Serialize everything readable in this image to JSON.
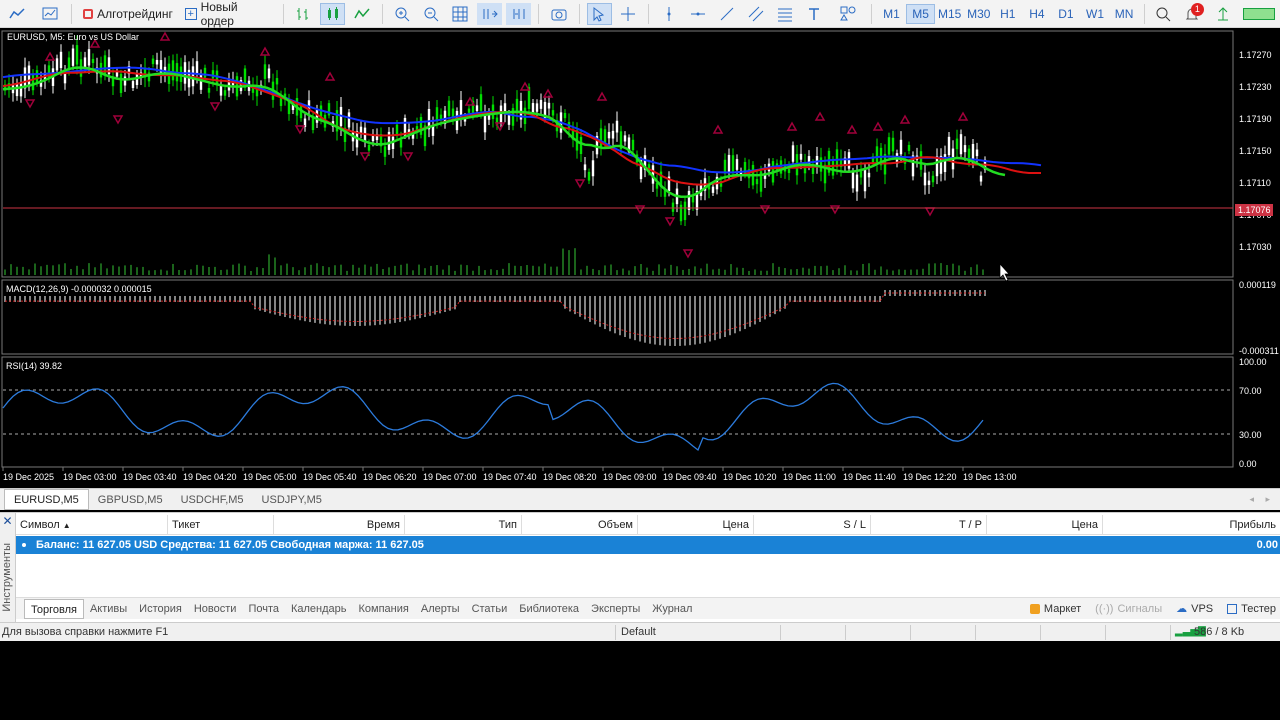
{
  "toolbar": {
    "algo_label": "Алготрейдинг",
    "new_order_label": "Новый ордер",
    "timeframes": [
      "M1",
      "M5",
      "M15",
      "M30",
      "H1",
      "H4",
      "D1",
      "W1",
      "MN"
    ],
    "active_timeframe": "M5",
    "notification_count": "1"
  },
  "chart": {
    "symbol_caption": "EURUSD, M5:  Euro vs US Dollar",
    "current_price_tag": "1.17076",
    "price_axis": [
      "1.17270",
      "1.17230",
      "1.17190",
      "1.17150",
      "1.17110",
      "1.17070",
      "1.17030"
    ],
    "macd_caption": "MACD(12,26,9) -0.000032 0.000015",
    "macd_axis_top": "0.000119",
    "macd_axis_bottom": "-0.000311",
    "rsi_caption": "RSI(14) 39.82",
    "rsi_axis": [
      "100.00",
      "70.00",
      "30.00",
      "0.00"
    ],
    "time_axis": [
      "19 Dec 2025",
      "19 Dec 03:00",
      "19 Dec 03:40",
      "19 Dec 04:20",
      "19 Dec 05:00",
      "19 Dec 05:40",
      "19 Dec 06:20",
      "19 Dec 07:00",
      "19 Dec 07:40",
      "19 Dec 08:20",
      "19 Dec 09:00",
      "19 Dec 09:40",
      "19 Dec 10:20",
      "19 Dec 11:00",
      "19 Dec 11:40",
      "19 Dec 12:20",
      "19 Dec 13:00"
    ],
    "colors": {
      "bull": "#00e000",
      "bear": "#ffffff",
      "ma_fast": "#22dd22",
      "ma_mid": "#dd1111",
      "ma_slow": "#1133ff",
      "fractal": "#a0003a",
      "bid_line": "#cc3344",
      "rsi": "#2c7bdc"
    }
  },
  "symbol_tabs": [
    "EURUSD,M5",
    "GBPUSD,M5",
    "USDCHF,M5",
    "USDJPY,M5"
  ],
  "toolbox": {
    "side_label": "Инструменты",
    "columns": [
      "Символ",
      "Тикет",
      "Время",
      "Тип",
      "Объем",
      "Цена",
      "S / L",
      "T / P",
      "Цена",
      "Прибыль"
    ],
    "balance_text": "Баланс: 11 627.05 USD  Средства: 11 627.05  Свободная маржа: 11 627.05",
    "profit": "0.00",
    "tabs": [
      "Торговля",
      "Активы",
      "История",
      "Новости",
      "Почта",
      "Календарь",
      "Компания",
      "Алерты",
      "Статьи",
      "Библиотека",
      "Эксперты",
      "Журнал"
    ],
    "right_tabs": [
      "Маркет",
      "Сигналы",
      "VPS",
      "Тестер"
    ]
  },
  "status": {
    "help": "Для вызова справки нажмите F1",
    "profile": "Default",
    "traffic": "586 / 8 Kb"
  }
}
